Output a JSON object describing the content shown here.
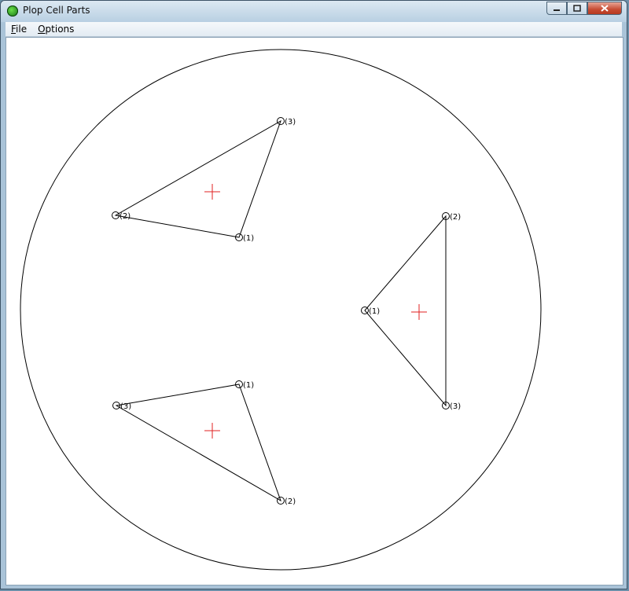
{
  "window": {
    "title": "Plop Cell Parts",
    "icon": "app-cell-icon"
  },
  "caption": {
    "minimize": "minimize-icon",
    "maximize": "maximize-icon",
    "close": "close-icon"
  },
  "menu": {
    "file": {
      "mnemonic": "F",
      "rest": "ile"
    },
    "options": {
      "mnemonic": "O",
      "rest": "ptions"
    }
  },
  "diagram": {
    "boundary": "large circle",
    "triangles": [
      {
        "labels": [
          "(1)",
          "(2)",
          "(3)"
        ],
        "centroid_marker": "red-cross"
      },
      {
        "labels": [
          "(1)",
          "(2)",
          "(3)"
        ],
        "centroid_marker": "red-cross"
      },
      {
        "labels": [
          "(1)",
          "(2)",
          "(3)"
        ],
        "centroid_marker": "red-cross"
      }
    ]
  },
  "colors": {
    "marker": "#e02020",
    "line": "#000000",
    "background": "#ffffff"
  }
}
